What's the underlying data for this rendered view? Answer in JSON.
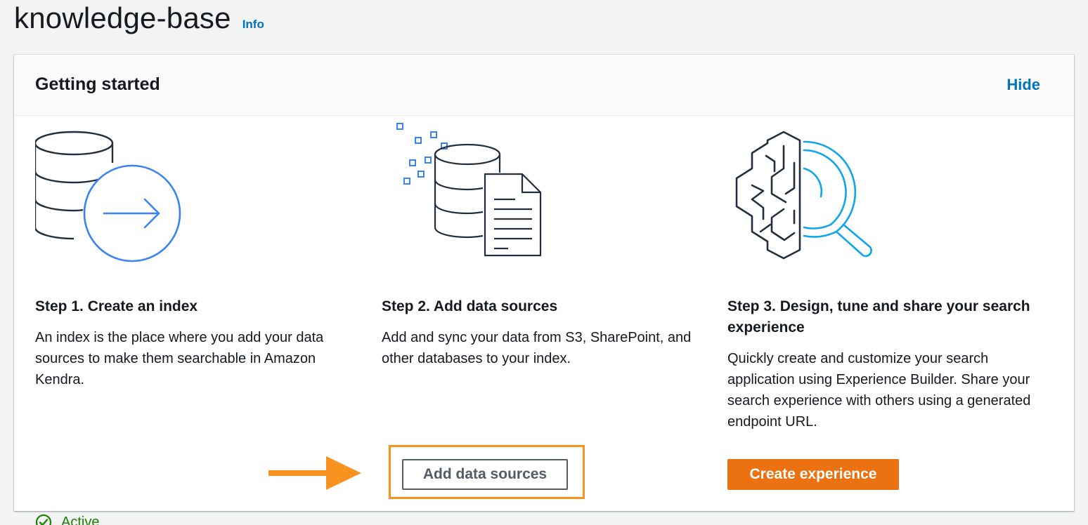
{
  "header": {
    "page_title": "knowledge-base",
    "info_label": "Info"
  },
  "panel": {
    "title": "Getting started",
    "hide_label": "Hide"
  },
  "steps": [
    {
      "title": "Step 1. Create an index",
      "description": "An index is the place where you add your data sources to make them searchable in Amazon Kendra.",
      "status_label": "Active",
      "icon": "database-arrow-icon"
    },
    {
      "title": "Step 2. Add data sources",
      "description": "Add and sync your data from S3, SharePoint, and other databases to your index.",
      "button_label": "Add data sources",
      "icon": "database-document-icon"
    },
    {
      "title": "Step 3. Design, tune and share your search experience",
      "description": "Quickly create and customize your search application using Experience Builder. Share your search experience with others using a generated endpoint URL.",
      "button_label": "Create experience",
      "icon": "brain-search-icon"
    }
  ],
  "colors": {
    "link": "#0073bb",
    "primary_button": "#ec7211",
    "status_active": "#1d8102",
    "annotation": "#f7931e",
    "illustration_accent": "#3b82f6"
  }
}
